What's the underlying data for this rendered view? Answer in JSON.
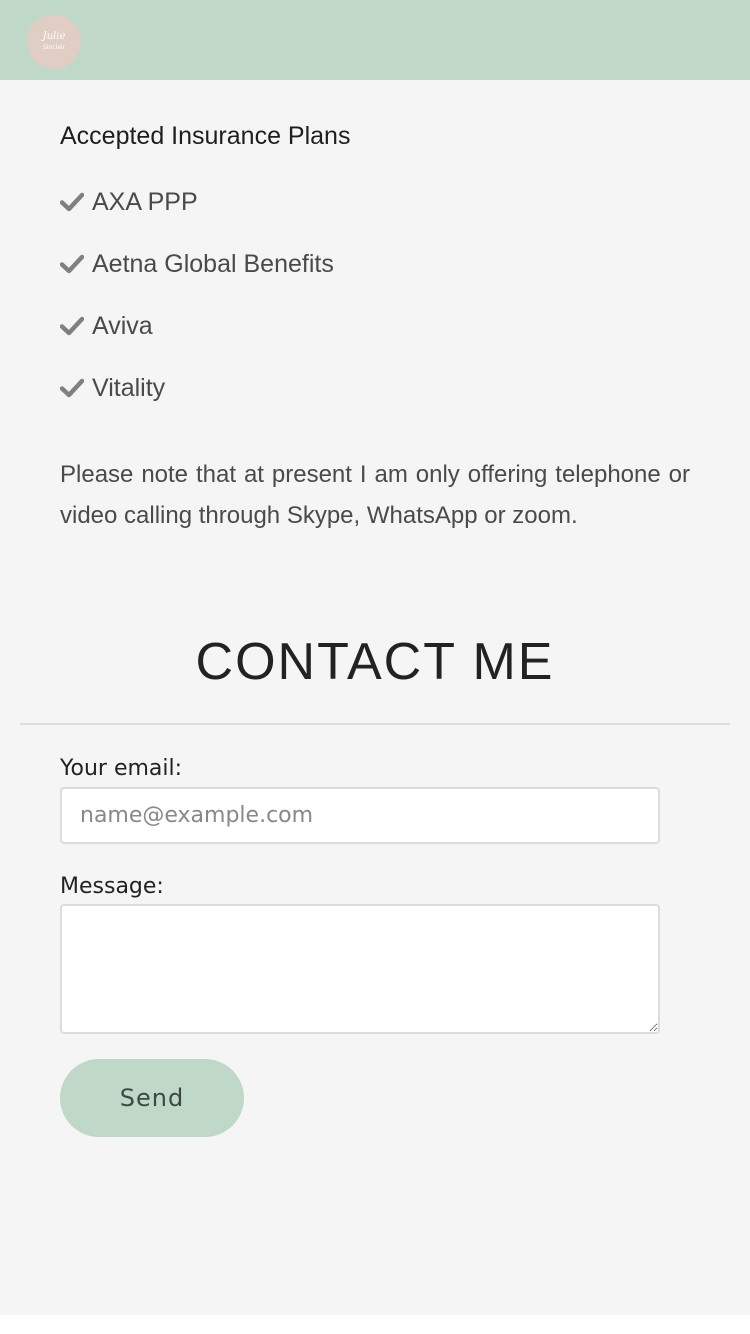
{
  "header": {
    "logo_line1": "Julie",
    "logo_line2": "Sinclair"
  },
  "insurance": {
    "heading": "Accepted Insurance Plans",
    "plans": [
      {
        "label": "AXA PPP",
        "icon": "check-icon"
      },
      {
        "label": "Aetna Global Benefits",
        "icon": "check-icon"
      },
      {
        "label": "Aviva",
        "icon": "check-icon"
      },
      {
        "label": "Vitality",
        "icon": "check-icon"
      }
    ]
  },
  "note": "Please note that at present I am only offering telephone or video calling through Skype, WhatsApp or zoom.",
  "contact": {
    "title": "CONTACT ME",
    "email_label": "Your email:",
    "email_placeholder": "name@example.com",
    "email_value": "",
    "message_label": "Message:",
    "message_value": "",
    "send_label": "Send"
  },
  "colors": {
    "header_background": "#bfd8c8",
    "logo_background": "#e0cdc4",
    "page_background": "#f5f5f5",
    "check_icon": "#808080",
    "button_background": "#bfd8c8"
  }
}
